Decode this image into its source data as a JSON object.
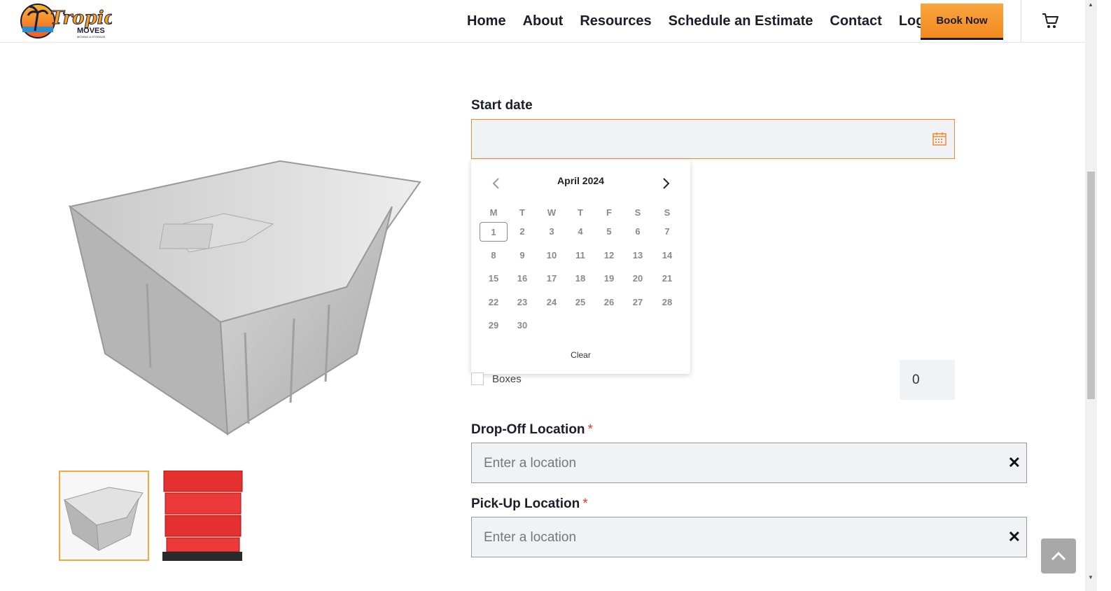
{
  "header": {
    "logo_text": "Tropical",
    "logo_sub": "MOVES",
    "logo_tag": "MOVING & STORAGE",
    "nav": [
      "Home",
      "About",
      "Resources",
      "Schedule an Estimate",
      "Contact",
      "Login"
    ],
    "book_now": "Book Now",
    "cart_icon": "cart-icon"
  },
  "form": {
    "start_date_label": "Start date",
    "start_date_value": "",
    "calendar": {
      "month_label": "April 2024",
      "weekdays": [
        "M",
        "T",
        "W",
        "T",
        "F",
        "S",
        "S"
      ],
      "weeks": [
        [
          "1",
          "2",
          "3",
          "4",
          "5",
          "6",
          "7"
        ],
        [
          "8",
          "9",
          "10",
          "11",
          "12",
          "13",
          "14"
        ],
        [
          "15",
          "16",
          "17",
          "18",
          "19",
          "20",
          "21"
        ],
        [
          "22",
          "23",
          "24",
          "25",
          "26",
          "27",
          "28"
        ],
        [
          "29",
          "30"
        ]
      ],
      "today": "1",
      "clear_label": "Clear"
    },
    "boxes_label": "Boxes",
    "boxes_qty": "0",
    "dropoff_label": "Drop-Off Location",
    "dropoff_placeholder": "Enter a location",
    "pickup_label": "Pick-Up Location",
    "pickup_placeholder": "Enter a location",
    "required_mark": "*"
  },
  "colors": {
    "accent": "#f28a1e",
    "navy": "#1b1b3a",
    "input_bg": "#f1f2f6"
  }
}
